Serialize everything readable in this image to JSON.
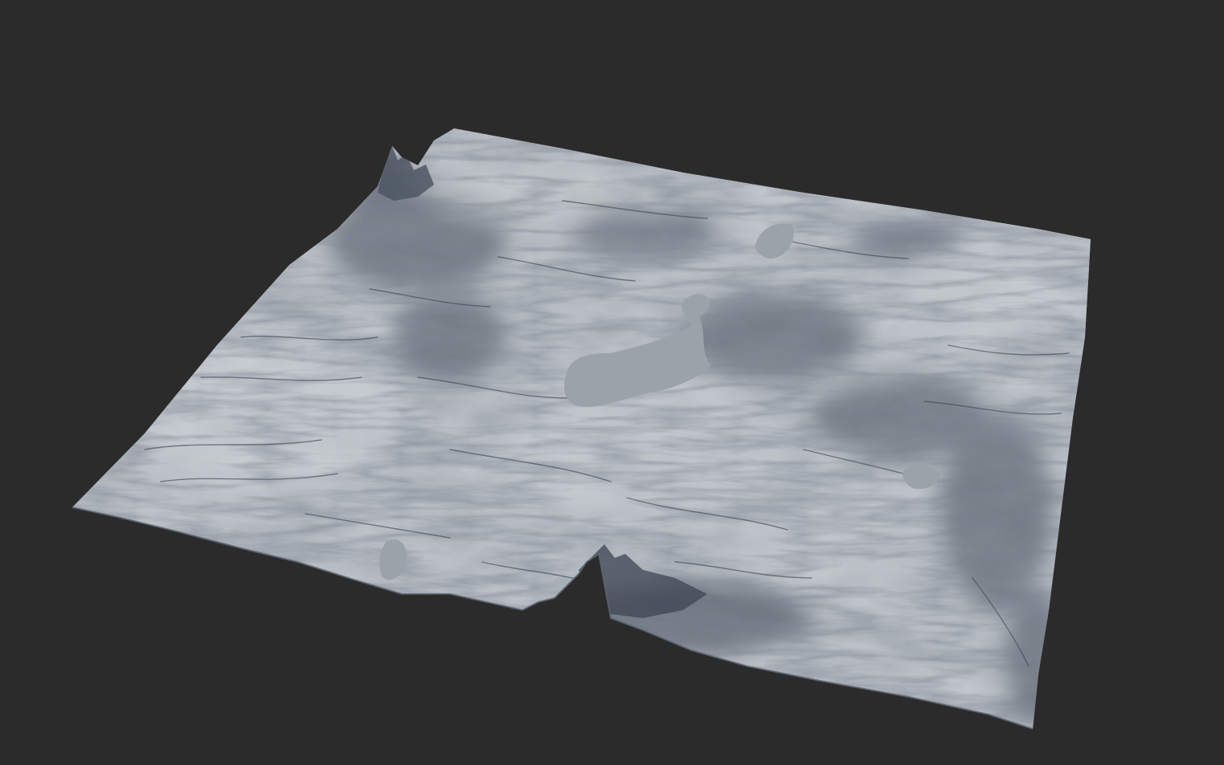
{
  "scene": {
    "background_color": "#2b2b2b",
    "subject": "terrain-mesh",
    "terrain_base_color": "#9ea4ab",
    "terrain_highlight_color": "#c3c8cd",
    "terrain_shadow_color": "#3c4452",
    "water_color": "#9aa1a8",
    "has_visible_text": false
  }
}
